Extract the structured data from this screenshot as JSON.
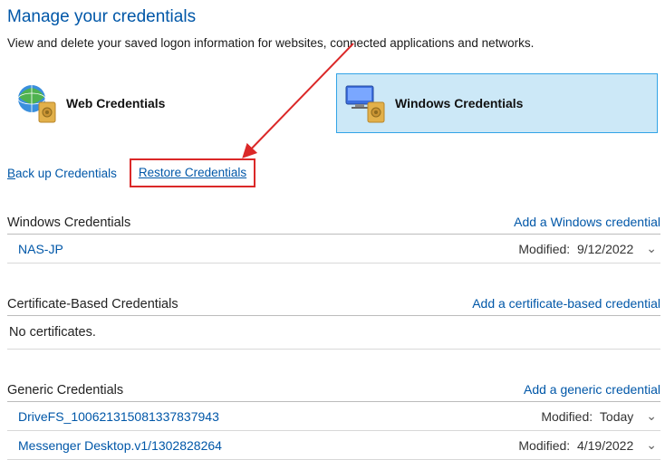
{
  "page": {
    "title": "Manage your credentials",
    "subtitle": "View and delete your saved logon information for websites, connected applications and networks."
  },
  "tabs": {
    "web_label": "Web Credentials",
    "windows_label": "Windows Credentials"
  },
  "links": {
    "backup": "ack up Credentials",
    "backup_hotkey": "B",
    "restore": "estore Credentials",
    "restore_hotkey": "R"
  },
  "sections": {
    "windows": {
      "title": "Windows Credentials",
      "add": "Add a Windows credential",
      "items": [
        {
          "name": "NAS-JP",
          "modified_label": "Modified:",
          "modified_value": "9/12/2022"
        }
      ]
    },
    "cert": {
      "title": "Certificate-Based Credentials",
      "add": "Add a certificate-based credential",
      "empty": "No certificates."
    },
    "generic": {
      "title": "Generic Credentials",
      "add": "Add a generic credential",
      "items": [
        {
          "name": "DriveFS_100621315081337837943",
          "modified_label": "Modified:",
          "modified_value": "Today"
        },
        {
          "name": "Messenger Desktop.v1/1302828264",
          "modified_label": "Modified:",
          "modified_value": "4/19/2022"
        }
      ]
    }
  }
}
